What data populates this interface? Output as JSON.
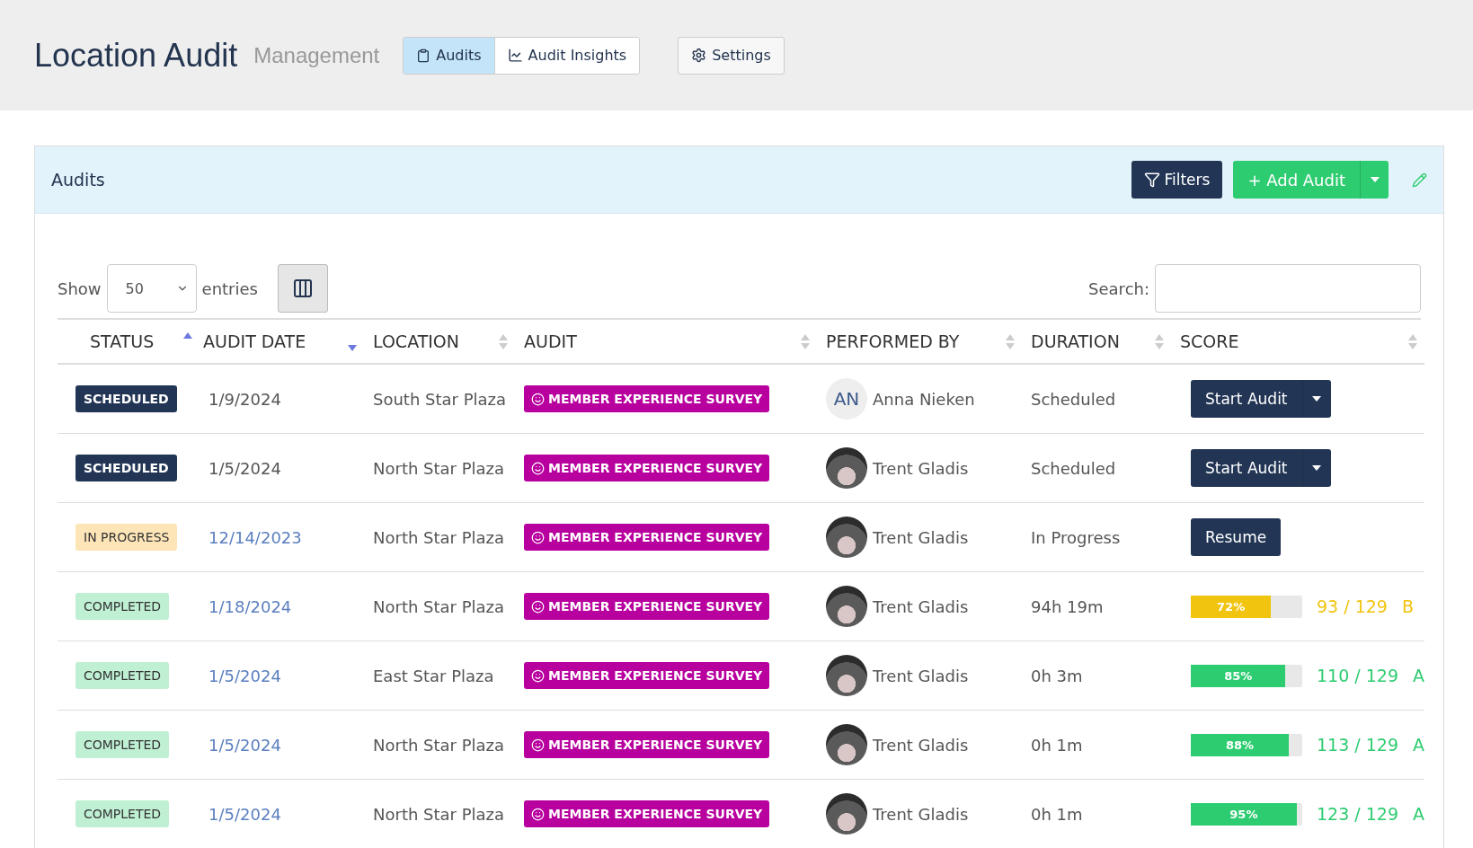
{
  "header": {
    "title": "Location Audit",
    "subtitle": "Management",
    "nav": [
      {
        "label": "Audits",
        "selected": true
      },
      {
        "label": "Audit Insights",
        "selected": false
      }
    ],
    "settings": "Settings"
  },
  "card": {
    "title": "Audits",
    "filters": "Filters",
    "add": "+ Add Audit"
  },
  "controls": {
    "show": "Show",
    "entries_value": "50",
    "entries": "entries",
    "search_label": "Search:"
  },
  "columns": [
    {
      "label": "STATUS",
      "kind": "ascending"
    },
    {
      "label": "AUDIT DATE",
      "kind": "descending"
    },
    {
      "label": "LOCATION",
      "kind": "unsorted"
    },
    {
      "label": "AUDIT",
      "kind": "unsorted"
    },
    {
      "label": "PERFORMED BY",
      "kind": "unsorted"
    },
    {
      "label": "DURATION",
      "kind": "unsorted"
    },
    {
      "label": "SCORE",
      "kind": "unsorted"
    }
  ],
  "rows": [
    {
      "status": {
        "kind": "scheduled",
        "label": "SCHEDULED"
      },
      "date": "1/9/2024",
      "date_link": false,
      "location": "South Star Plaza",
      "audit": "MEMBER EXPERIENCE SURVEY",
      "avatar": {
        "kind": "initials",
        "text": "AN"
      },
      "performer": "Anna Nieken",
      "duration": "Scheduled",
      "score": {
        "kind": "start",
        "label": "Start Audit"
      }
    },
    {
      "status": {
        "kind": "scheduled",
        "label": "SCHEDULED"
      },
      "date": "1/5/2024",
      "date_link": false,
      "location": "North Star Plaza",
      "audit": "MEMBER EXPERIENCE SURVEY",
      "avatar": {
        "kind": "photo"
      },
      "performer": "Trent Gladis",
      "duration": "Scheduled",
      "score": {
        "kind": "start",
        "label": "Start Audit"
      }
    },
    {
      "status": {
        "kind": "in_progress",
        "label": "IN PROGRESS"
      },
      "date": "12/14/2023",
      "date_link": true,
      "location": "North Star Plaza",
      "audit": "MEMBER EXPERIENCE SURVEY",
      "avatar": {
        "kind": "photo"
      },
      "performer": "Trent Gladis",
      "duration": "In Progress",
      "score": {
        "kind": "resume",
        "label": "Resume"
      }
    },
    {
      "status": {
        "kind": "completed",
        "label": "COMPLETED"
      },
      "date": "1/18/2024",
      "date_link": true,
      "location": "North Star Plaza",
      "audit": "MEMBER EXPERIENCE SURVEY",
      "avatar": {
        "kind": "photo"
      },
      "performer": "Trent Gladis",
      "duration": "94h 19m",
      "score": {
        "kind": "result",
        "level": 0.72,
        "percent": "72%",
        "points": "93 / 129",
        "grade": "B",
        "color": "#f1c40f"
      }
    },
    {
      "status": {
        "kind": "completed",
        "label": "COMPLETED"
      },
      "date": "1/5/2024",
      "date_link": true,
      "location": "East Star Plaza",
      "audit": "MEMBER EXPERIENCE SURVEY",
      "avatar": {
        "kind": "photo"
      },
      "performer": "Trent Gladis",
      "duration": "0h 3m",
      "score": {
        "kind": "result",
        "level": 0.85,
        "percent": "85%",
        "points": "110 / 129",
        "grade": "A",
        "color": "#2ecc71"
      }
    },
    {
      "status": {
        "kind": "completed",
        "label": "COMPLETED"
      },
      "date": "1/5/2024",
      "date_link": true,
      "location": "North Star Plaza",
      "audit": "MEMBER EXPERIENCE SURVEY",
      "avatar": {
        "kind": "photo"
      },
      "performer": "Trent Gladis",
      "duration": "0h 1m",
      "score": {
        "kind": "result",
        "level": 0.88,
        "percent": "88%",
        "points": "113 / 129",
        "grade": "A",
        "color": "#2ecc71"
      }
    },
    {
      "status": {
        "kind": "completed",
        "label": "COMPLETED"
      },
      "date": "1/5/2024",
      "date_link": true,
      "location": "North Star Plaza",
      "audit": "MEMBER EXPERIENCE SURVEY",
      "avatar": {
        "kind": "photo"
      },
      "performer": "Trent Gladis",
      "duration": "0h 1m",
      "score": {
        "kind": "result",
        "level": 0.95,
        "percent": "95%",
        "points": "123 / 129",
        "grade": "A",
        "color": "#2ecc71"
      }
    }
  ]
}
